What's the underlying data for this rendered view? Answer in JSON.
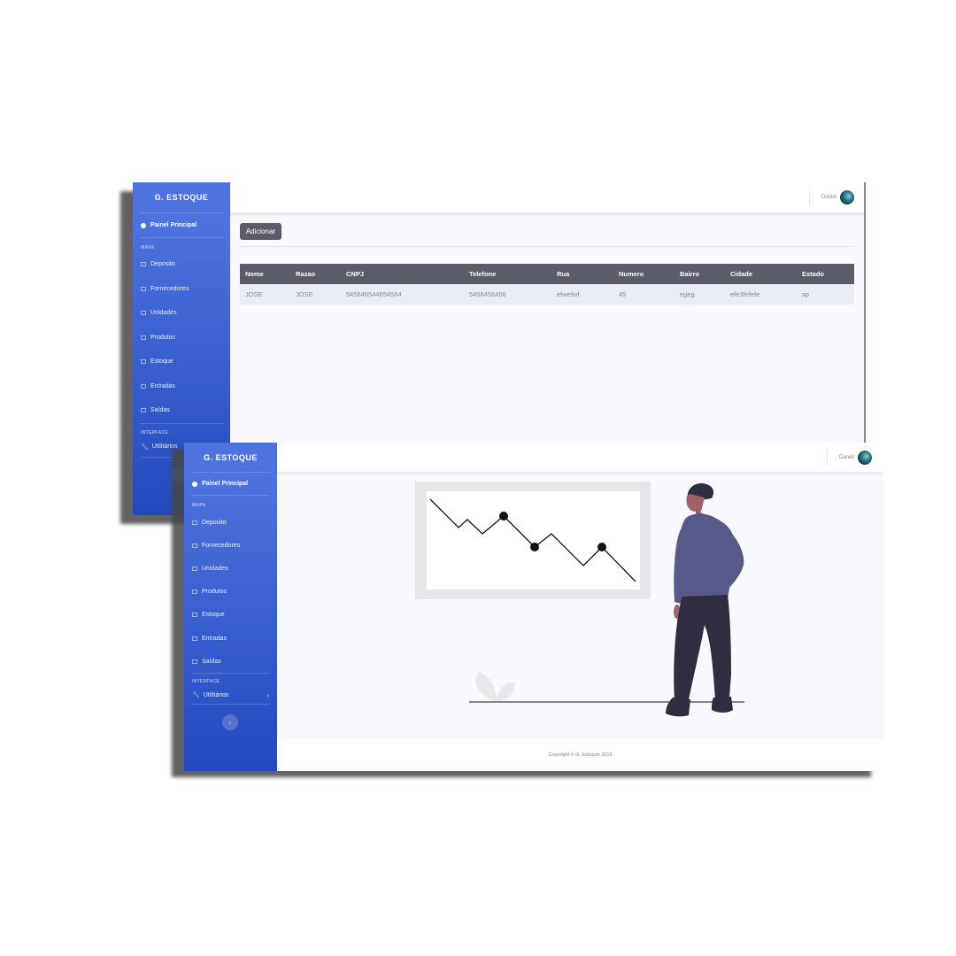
{
  "app": {
    "brand": "G. ESTOQUE",
    "dashboard_label": "Painel Principal",
    "section_mapa": "MAPA",
    "section_interface": "INTERFACE",
    "nav_items": [
      {
        "label": "Deposito",
        "icon": "table-icon"
      },
      {
        "label": "Fornecedores",
        "icon": "table-icon"
      },
      {
        "label": "Unidades",
        "icon": "table-icon"
      },
      {
        "label": "Produtos",
        "icon": "table-icon"
      },
      {
        "label": "Estoque",
        "icon": "table-icon"
      },
      {
        "label": "Entradas",
        "icon": "table-icon"
      },
      {
        "label": "Saídas",
        "icon": "table-icon"
      }
    ],
    "utilities_label": "Utilitários",
    "toggle_glyph": "‹",
    "user_name": "Daniel",
    "colors": {
      "sidebar_start": "#4e73df",
      "sidebar_end": "#224abe",
      "header_dark": "#5a5c69",
      "page_bg": "#f8f9fc"
    }
  },
  "fornecedores_view": {
    "add_button": "Adicionar",
    "table": {
      "columns": [
        "Nome",
        "Razao",
        "CNPJ",
        "Telefone",
        "Rua",
        "Numero",
        "Bairro",
        "Cidade",
        "Estado"
      ],
      "rows": [
        [
          "JOSE",
          "JOSE",
          "545646544654564",
          "5456456456",
          "efwefwf",
          "45",
          "egeg",
          "efe3fefefe",
          "sp"
        ]
      ]
    }
  },
  "dashboard_view": {
    "illustration": "person-viewing-declining-chart",
    "footer": "Copyright © G. Estoque 2019"
  }
}
